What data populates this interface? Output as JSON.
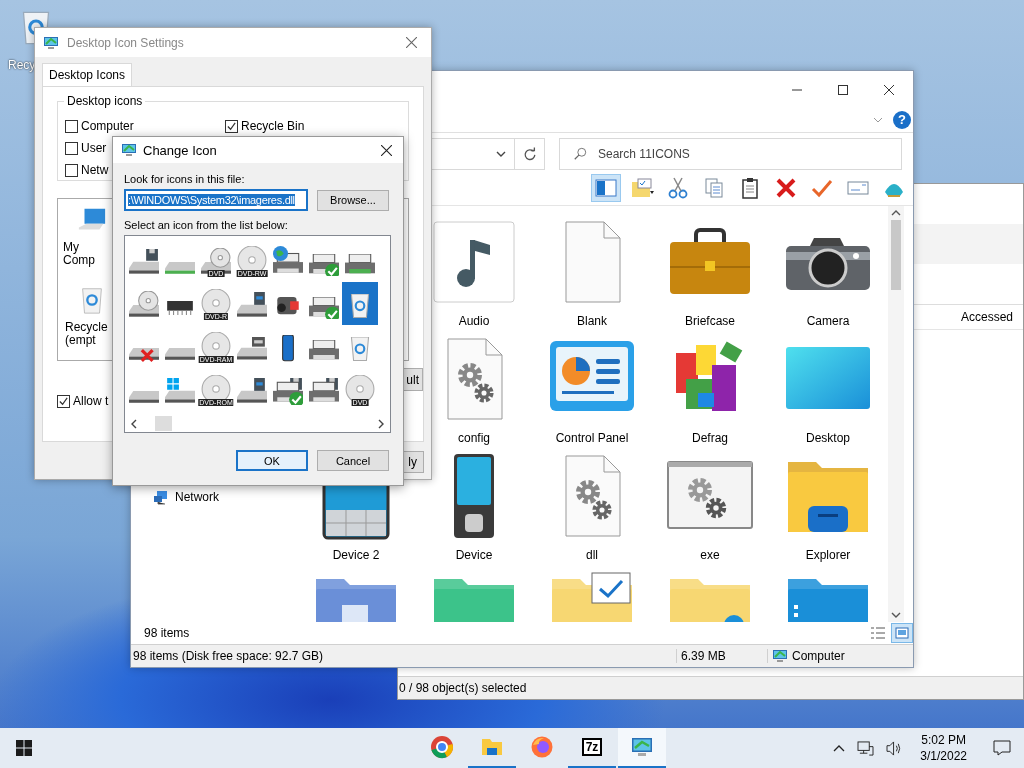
{
  "desktop_icons": [
    {
      "label": "Recy"
    }
  ],
  "back_window": {
    "column_header": "Accessed",
    "status": "0 / 98 object(s) selected"
  },
  "explorer": {
    "help": "?",
    "search": {
      "placeholder": "Search 11ICONS"
    },
    "preview_pane": {
      "on": true
    },
    "toolbar": [
      {
        "kind": "folder-options"
      },
      {
        "kind": "cut"
      },
      {
        "kind": "copy"
      },
      {
        "kind": "paste"
      },
      {
        "kind": "delete"
      },
      {
        "kind": "check"
      },
      {
        "kind": "mail"
      },
      {
        "kind": "shell"
      }
    ],
    "nav": [
      {
        "label": "Network"
      }
    ],
    "rows": [
      {
        "items": [
          {
            "kind": "music",
            "label": "Audio"
          },
          {
            "kind": "blank",
            "label": "Blank"
          },
          {
            "kind": "briefcase",
            "label": "Briefcase"
          },
          {
            "kind": "camera",
            "label": "Camera"
          }
        ]
      },
      {
        "items": [
          {
            "kind": "config",
            "label": "config"
          },
          {
            "kind": "control-panel",
            "label": "Control Panel"
          },
          {
            "kind": "defrag",
            "label": "Defrag"
          },
          {
            "kind": "desktop",
            "label": "Desktop"
          }
        ]
      },
      {
        "items": [
          {
            "kind": "tablet",
            "label": "Device 2"
          },
          {
            "kind": "device",
            "label": "Device"
          },
          {
            "kind": "config",
            "label": "dll"
          },
          {
            "kind": "exe",
            "label": "exe"
          },
          {
            "kind": "folder-explorer",
            "label": "Explorer"
          }
        ]
      },
      {
        "items": [
          {
            "kind": "folder-cube"
          },
          {
            "kind": "folder-green"
          },
          {
            "kind": "folder-check"
          },
          {
            "kind": "folder-yellow"
          },
          {
            "kind": "folder-blue"
          }
        ]
      }
    ],
    "count": "98 items",
    "views": [
      {
        "kind": "details",
        "selected": false
      },
      {
        "kind": "icons",
        "selected": true
      }
    ],
    "status": {
      "text": "98 items (Disk free space: 92.7 GB)",
      "size": "6.39 MB",
      "location": "Computer"
    }
  },
  "icon_settings": {
    "title": "Desktop Icon Settings",
    "tabs": [
      {
        "label": "Desktop Icons",
        "selected": true
      }
    ],
    "group": "Desktop icons",
    "checkboxes": [
      {
        "label": "Computer",
        "checked": false
      },
      {
        "label": "User",
        "checked": false
      },
      {
        "label": "Netw",
        "checked": false
      },
      {
        "label": "Recycle Bin",
        "checked": true
      }
    ],
    "previews": [
      {
        "kind": "computer",
        "label": "My Comp"
      },
      {
        "kind": "recycle-bin",
        "label": "Recycle (empt"
      }
    ],
    "restore_button": "ult",
    "allow_checkbox": {
      "label": "Allow t",
      "checked": true
    },
    "apply_button": "ly"
  },
  "change_icon": {
    "title": "Change Icon",
    "file_label": "Look for icons in this file:",
    "file_value": ":\\WINDOWS\\System32\\imageres.dll",
    "browse": "Browse...",
    "list_label": "Select an icon from the list below:",
    "icons": [
      {
        "kind": "floppy-drive",
        "selected": false
      },
      {
        "kind": "network-drive",
        "selected": false
      },
      {
        "kind": "dvd-drive",
        "label": "DVD",
        "selected": false
      },
      {
        "kind": "disc",
        "label": "DVD-RW",
        "selected": false
      },
      {
        "kind": "globe-printer",
        "selected": false
      },
      {
        "kind": "printer-check",
        "selected": false
      },
      {
        "kind": "printer-tray",
        "selected": false
      },
      {
        "kind": "cd-drive",
        "selected": false
      },
      {
        "kind": "chip",
        "selected": false
      },
      {
        "kind": "disc",
        "label": "DVD-R",
        "selected": false
      },
      {
        "kind": "card-drive",
        "selected": false
      },
      {
        "kind": "camcorder",
        "selected": false
      },
      {
        "kind": "printer-check",
        "selected": false
      },
      {
        "kind": "recycle-bin",
        "selected": true
      },
      {
        "kind": "drive-x",
        "selected": false
      },
      {
        "kind": "drive",
        "selected": false
      },
      {
        "kind": "disc",
        "label": "DVD-RAM",
        "selected": false
      },
      {
        "kind": "tape-drive",
        "selected": false
      },
      {
        "kind": "phone",
        "selected": false
      },
      {
        "kind": "printer",
        "selected": false
      },
      {
        "kind": "recycle-bin",
        "selected": false
      },
      {
        "kind": "drive",
        "selected": false
      },
      {
        "kind": "windows-drive",
        "selected": false
      },
      {
        "kind": "disc",
        "label": "DVD-ROM",
        "selected": false
      },
      {
        "kind": "card-drive",
        "selected": false
      },
      {
        "kind": "floppy-printer-check",
        "selected": false
      },
      {
        "kind": "floppy-printer",
        "selected": false
      },
      {
        "kind": "disc",
        "label": "DVD",
        "selected": false
      }
    ],
    "ok": "OK",
    "cancel": "Cancel"
  },
  "taskbar": {
    "apps": [
      {
        "kind": "chrome",
        "running": false,
        "active": false
      },
      {
        "kind": "folder",
        "running": true,
        "active": false
      },
      {
        "kind": "firefox",
        "running": false,
        "active": false
      },
      {
        "kind": "archiver",
        "label": "7z",
        "running": true,
        "active": false
      },
      {
        "kind": "monitor",
        "running": true,
        "active": true
      }
    ],
    "time": "5:02 PM",
    "date": "3/1/2022"
  }
}
